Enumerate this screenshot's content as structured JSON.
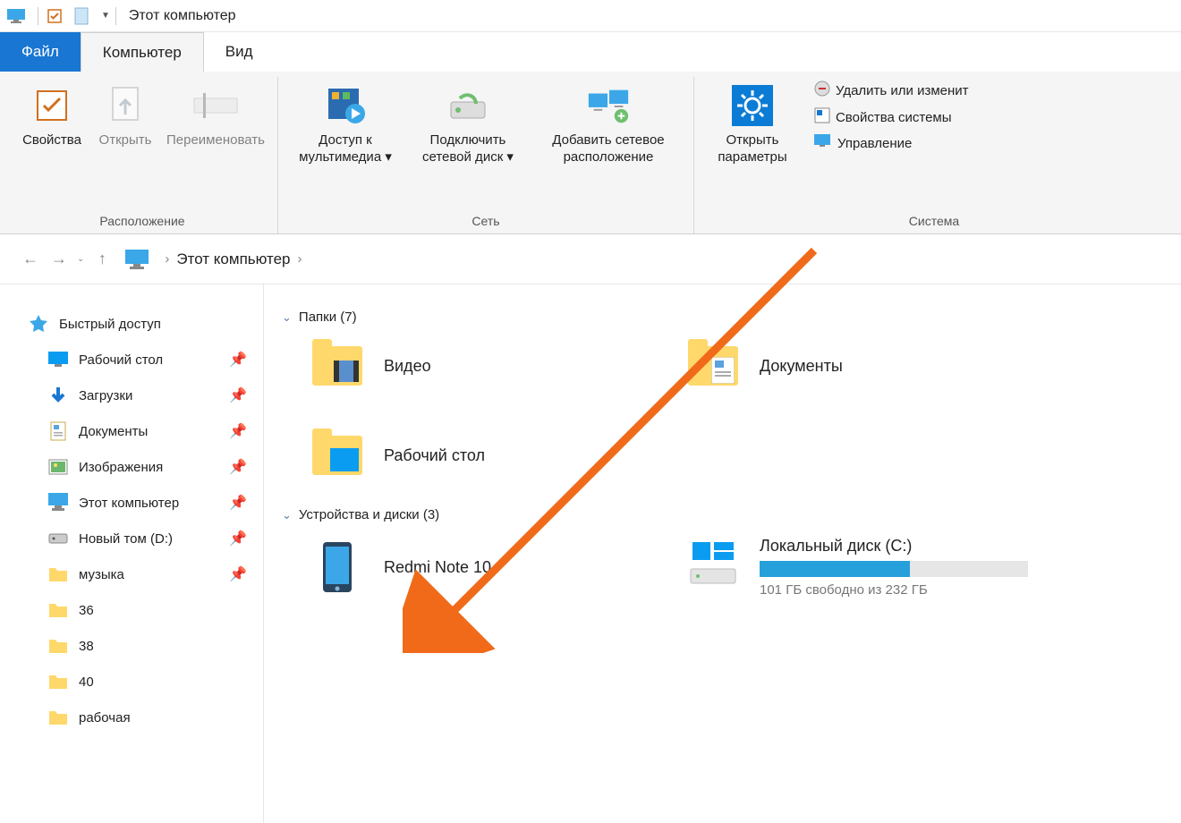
{
  "titlebar": {
    "title": "Этот компьютер"
  },
  "tabs": {
    "file": "Файл",
    "computer": "Компьютер",
    "view": "Вид"
  },
  "ribbon": {
    "location": {
      "label": "Расположение",
      "properties": "Свойства",
      "open": "Открыть",
      "rename": "Переименовать"
    },
    "network": {
      "label": "Сеть",
      "media": "Доступ к\nмультимедиа ▾",
      "mapdrive": "Подключить\nсетевой диск ▾",
      "addlocation": "Добавить сетевое\nрасположение"
    },
    "system": {
      "label": "Система",
      "opensettings": "Открыть\nпараметры",
      "uninstall": "Удалить или изменит",
      "sysprops": "Свойства системы",
      "manage": "Управление"
    }
  },
  "address": {
    "location": "Этот компьютер"
  },
  "sidebar": {
    "quick": "Быстрый доступ",
    "items": [
      {
        "label": "Рабочий стол",
        "pinned": true,
        "icon": "desktop"
      },
      {
        "label": "Загрузки",
        "pinned": true,
        "icon": "download"
      },
      {
        "label": "Документы",
        "pinned": true,
        "icon": "documents"
      },
      {
        "label": "Изображения",
        "pinned": true,
        "icon": "pictures"
      },
      {
        "label": "Этот компьютер",
        "pinned": true,
        "icon": "pc"
      },
      {
        "label": "Новый том (D:)",
        "pinned": true,
        "icon": "drive"
      },
      {
        "label": "музыка",
        "pinned": true,
        "icon": "folder"
      },
      {
        "label": "36",
        "pinned": false,
        "icon": "folder"
      },
      {
        "label": "38",
        "pinned": false,
        "icon": "folder"
      },
      {
        "label": "40",
        "pinned": false,
        "icon": "folder"
      },
      {
        "label": "рабочая",
        "pinned": false,
        "icon": "folder"
      }
    ]
  },
  "folders": {
    "header": "Папки (7)",
    "items": [
      {
        "label": "Видео"
      },
      {
        "label": "Документы"
      },
      {
        "label": "Рабочий стол"
      }
    ]
  },
  "devices": {
    "header": "Устройства и диски (3)",
    "phone": {
      "label": "Redmi Note 10"
    },
    "disk": {
      "label": "Локальный диск (C:)",
      "free": "101 ГБ свободно из 232 ГБ",
      "fillpct": 56
    }
  }
}
